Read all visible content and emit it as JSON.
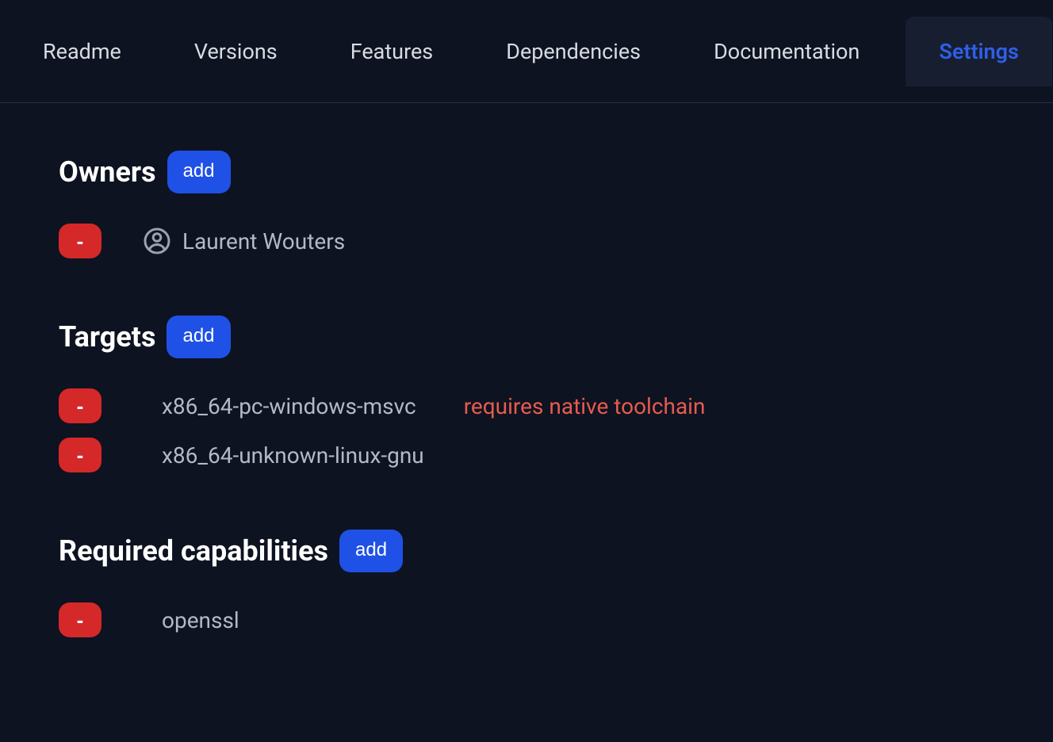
{
  "tabs": [
    {
      "label": "Readme"
    },
    {
      "label": "Versions"
    },
    {
      "label": "Features"
    },
    {
      "label": "Dependencies"
    },
    {
      "label": "Documentation"
    },
    {
      "label": "Settings"
    }
  ],
  "owners": {
    "title": "Owners",
    "add_label": "add",
    "items": [
      {
        "remove": "-",
        "name": "Laurent Wouters"
      }
    ]
  },
  "targets": {
    "title": "Targets",
    "add_label": "add",
    "items": [
      {
        "remove": "-",
        "name": "x86_64-pc-windows-msvc",
        "status": "requires native toolchain"
      },
      {
        "remove": "-",
        "name": "x86_64-unknown-linux-gnu",
        "status": ""
      }
    ]
  },
  "capabilities": {
    "title": "Required capabilities",
    "add_label": "add",
    "items": [
      {
        "remove": "-",
        "name": "openssl"
      }
    ]
  }
}
